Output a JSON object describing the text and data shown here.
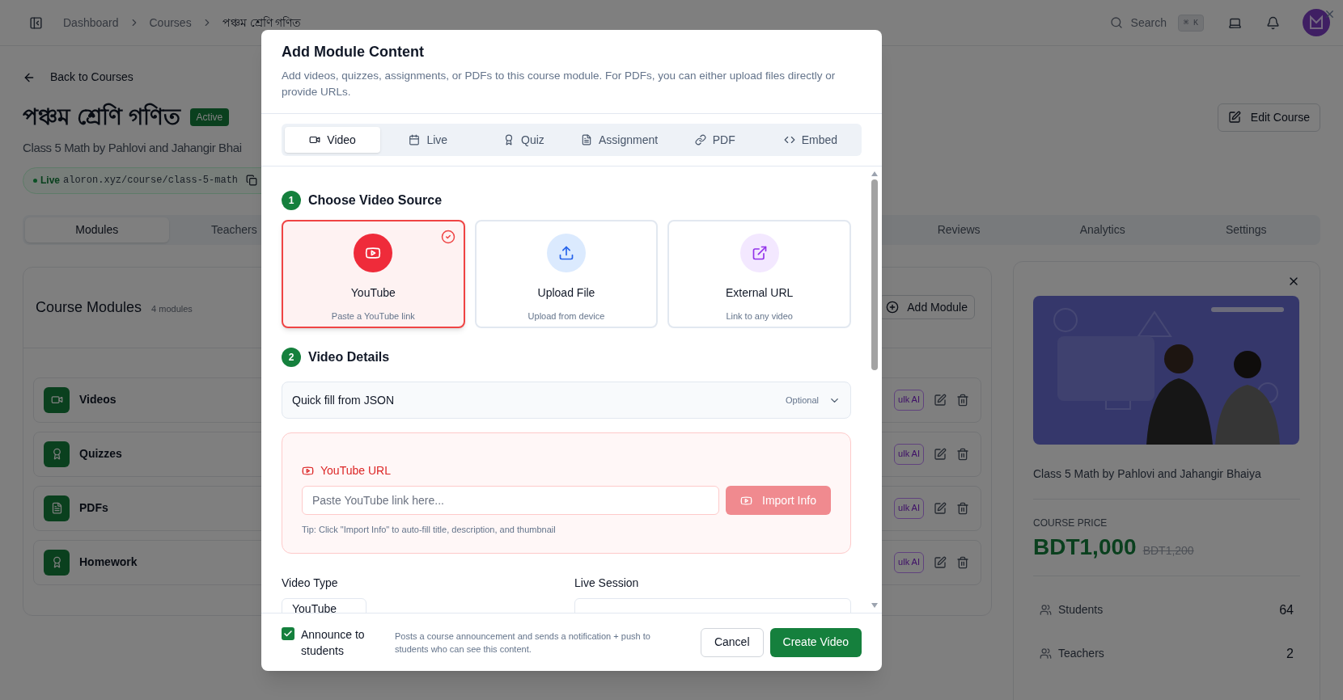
{
  "header": {
    "breadcrumbs": [
      {
        "label": "Dashboard",
        "current": false
      },
      {
        "label": "Courses",
        "current": false
      },
      {
        "label": "পঞ্চম শ্রেণি গণিত",
        "current": true
      }
    ],
    "search": {
      "label": "Search",
      "shortcut": "⌘ K"
    }
  },
  "back_link": "Back to Courses",
  "course": {
    "title": "পঞ্চম শ্রেণি গণিত",
    "status": "Active",
    "subtitle": "Class 5 Math by Pahlovi and Jahangir Bhai",
    "live_label": "Live",
    "url": "aloron.xyz/course/class-5-math",
    "edit_button": "Edit Course"
  },
  "tabs": [
    {
      "label": "Modules",
      "selected": true
    },
    {
      "label": "Teachers",
      "selected": false
    },
    {
      "label": "Reviews",
      "selected": false
    },
    {
      "label": "Analytics",
      "selected": false
    },
    {
      "label": "Settings",
      "selected": false
    }
  ],
  "modules_card": {
    "title": "Course Modules",
    "count": "4 modules",
    "add_button": "Add Module",
    "modules": [
      {
        "name": "Videos",
        "kind": "video",
        "action": "ulk AI"
      },
      {
        "name": "Quizzes",
        "kind": "quiz",
        "action": "ulk AI"
      },
      {
        "name": "PDFs",
        "kind": "pdf",
        "action": "ulk AI"
      },
      {
        "name": "Homework",
        "kind": "homework",
        "action": "ulk AI"
      }
    ]
  },
  "course_card": {
    "caption": "Class 5 Math by Pahlovi and Jahangir Bhaiya",
    "price_label": "COURSE PRICE",
    "price": "BDT1,000",
    "old_price": "BDT1,200",
    "stats": [
      {
        "label": "Students",
        "value": "64"
      },
      {
        "label": "Teachers",
        "value": "2"
      }
    ]
  },
  "modal": {
    "title": "Add Module Content",
    "description": "Add videos, quizzes, assignments, or PDFs to this course module. For PDFs, you can either upload files directly or provide URLs.",
    "tabs": [
      {
        "label": "Video",
        "kind": "video",
        "selected": true
      },
      {
        "label": "Live",
        "kind": "live",
        "selected": false
      },
      {
        "label": "Quiz",
        "kind": "quiz",
        "selected": false
      },
      {
        "label": "Assignment",
        "kind": "assignment",
        "selected": false
      },
      {
        "label": "PDF",
        "kind": "pdf",
        "selected": false
      },
      {
        "label": "Embed",
        "kind": "embed",
        "selected": false
      }
    ],
    "step1": {
      "number": "1",
      "title": "Choose Video Source"
    },
    "sources": [
      {
        "title": "YouTube",
        "subtitle": "Paste a YouTube link",
        "kind": "youtube",
        "selected": true
      },
      {
        "title": "Upload File",
        "subtitle": "Upload from device",
        "kind": "upload",
        "selected": false
      },
      {
        "title": "External URL",
        "subtitle": "Link to any video",
        "kind": "external",
        "selected": false
      }
    ],
    "step2": {
      "number": "2",
      "title": "Video Details"
    },
    "quick_fill": {
      "label": "Quick fill from JSON",
      "badge": "Optional",
      "expanded": false
    },
    "url_box": {
      "label": "YouTube URL",
      "placeholder": "Paste YouTube link here...",
      "button": "Import Info",
      "button_disabled": true,
      "tip": "Tip: Click \"Import Info\" to auto-fill title, description, and thumbnail"
    },
    "fields": [
      {
        "label": "Video Type",
        "value": "YouTube"
      },
      {
        "label": "Live Session"
      }
    ],
    "announce": {
      "label": "Announce to students",
      "checked": true,
      "note": "Posts a course announcement and sends a notification + push to students who can see this content."
    },
    "cancel_button": "Cancel",
    "submit_button": "Create Video"
  }
}
